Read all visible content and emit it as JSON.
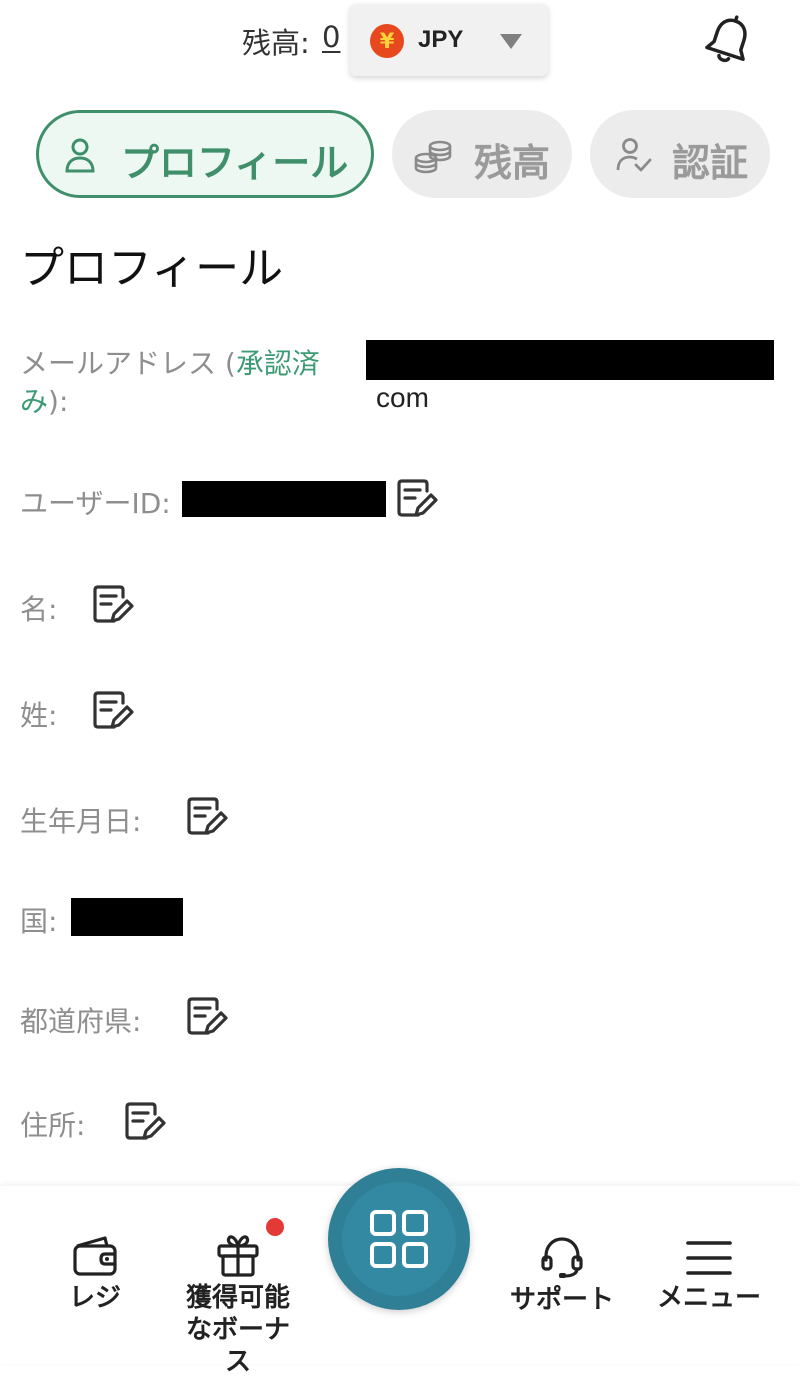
{
  "header": {
    "balance_label": "残高:",
    "balance_amount": "0",
    "currency_symbol": "¥",
    "currency_code": "JPY",
    "icons": [
      "bell-icon",
      "chevron-down-icon"
    ]
  },
  "tabs": [
    {
      "label": "プロフィール",
      "icon": "user-icon",
      "active": true
    },
    {
      "label": "残高",
      "icon": "coins-icon",
      "active": false
    },
    {
      "label": "認証",
      "icon": "user-check-icon",
      "active": false
    }
  ],
  "page_title": "プロフィール",
  "fields": {
    "email": {
      "label_prefix": "メールアドレス (",
      "status": "承認済",
      "label_line2_status": "み",
      "label_suffix": "):",
      "value_tail": "com"
    },
    "user_id": {
      "label": "ユーザーID:"
    },
    "first_name": {
      "label": "名:"
    },
    "last_name": {
      "label": "姓:"
    },
    "birthdate": {
      "label": "生年月日:"
    },
    "country": {
      "label": "国:"
    },
    "prefecture": {
      "label": "都道府県:"
    },
    "address": {
      "label": "住所:"
    }
  },
  "bottom_nav": {
    "cashier": {
      "label": "レジ",
      "icon": "wallet-icon"
    },
    "bonus": {
      "label_line1": "獲得可能",
      "label_line2": "なボーナ",
      "label_line3": "ス",
      "icon": "gift-icon"
    },
    "center": {
      "icon": "grid-icon"
    },
    "support": {
      "label": "サポート",
      "icon": "headset-icon"
    },
    "menu": {
      "label": "メニュー",
      "icon": "hamburger-icon"
    }
  },
  "colors": {
    "accent": "#3e8f6a",
    "fab": "#2f7f96",
    "notification": "#e53935",
    "yen_badge": "#e8481e"
  }
}
